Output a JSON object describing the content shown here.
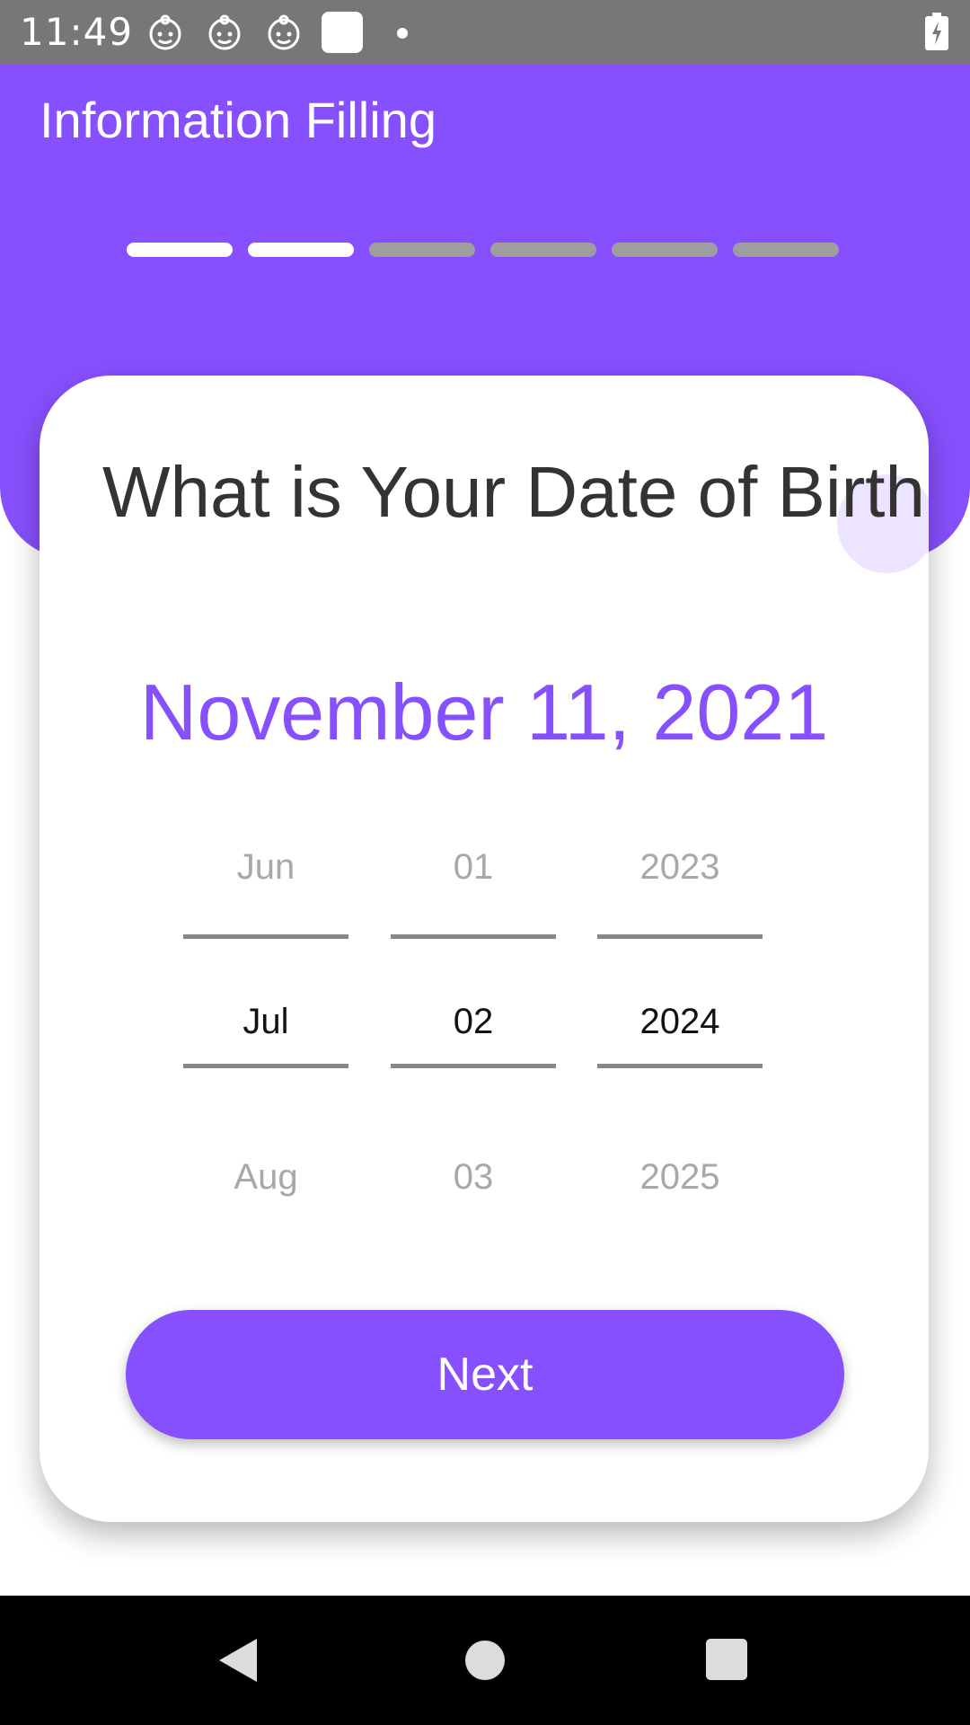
{
  "status_bar": {
    "time": "11:49",
    "icons": [
      "baby-face-icon",
      "baby-face-icon",
      "baby-face-icon",
      "square-icon",
      "dot-icon",
      "battery-charging-icon"
    ]
  },
  "header": {
    "title": "Information Filling",
    "progress": {
      "total_steps": 6,
      "completed_steps": 2
    }
  },
  "card": {
    "question": "What is Your Date of Birth",
    "selected_date": "November 11, 2021",
    "picker": {
      "month": {
        "prev": "Jun",
        "current": "Jul",
        "next": "Aug"
      },
      "day": {
        "prev": "01",
        "current": "02",
        "next": "03"
      },
      "year": {
        "prev": "2023",
        "current": "2024",
        "next": "2025"
      }
    },
    "next_label": "Next"
  },
  "nav_bar": {
    "icons": [
      "back-icon",
      "home-icon",
      "recents-icon"
    ]
  },
  "colors": {
    "accent": "#8750fe",
    "status_bar": "#777777",
    "progress_active": "#ffffff",
    "progress_inactive": "#9e9e9e",
    "nav_bar": "#000000"
  }
}
